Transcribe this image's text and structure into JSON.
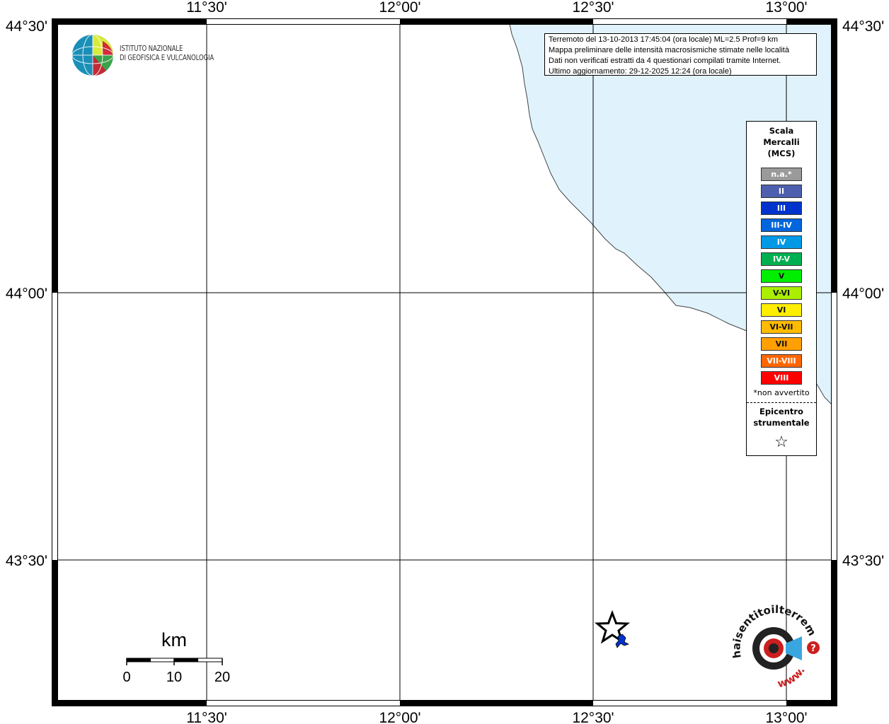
{
  "map": {
    "lon_labels": [
      "11°30'",
      "12°00'",
      "12°30'",
      "13°00'"
    ],
    "lat_labels": [
      "44°30'",
      "44°00'",
      "43°30'"
    ],
    "sea_color": "#e0f3fd",
    "frame_color": "#000000",
    "epicenter": {
      "symbol": "star-icon"
    },
    "felt_report": {
      "intensity": "III",
      "color": "#0033cc"
    }
  },
  "info": {
    "line1": "Terremoto del 13-10-2013 17:45:04 (ora locale) ML=2.5 Prof=9 km",
    "line2": "Mappa preliminare delle intensità macrosismiche stimate nelle località",
    "line3": "Dati non verificati estratti da 4 questionari compilati tramite Internet.",
    "line4": "Ultimo aggiornamento: 29-12-2025 12:24 (ora locale)"
  },
  "logo": {
    "line1": "ISTITUTO NAZIONALE",
    "line2": "DI GEOFISICA E VULCANOLOGIA"
  },
  "legend": {
    "title1": "Scala",
    "title2": "Mercalli",
    "title3": "(MCS)",
    "items": [
      {
        "label": "n.a.*",
        "color": "#9a9a9a"
      },
      {
        "label": "II",
        "color": "#4d5fae"
      },
      {
        "label": "III",
        "color": "#0033cc"
      },
      {
        "label": "III-IV",
        "color": "#0066dd"
      },
      {
        "label": "IV",
        "color": "#0099e6"
      },
      {
        "label": "IV-V",
        "color": "#00b050"
      },
      {
        "label": "V",
        "color": "#00ee00"
      },
      {
        "label": "V-VI",
        "color": "#aaee00"
      },
      {
        "label": "VI",
        "color": "#ffee00"
      },
      {
        "label": "VI-VII",
        "color": "#ffbb00"
      },
      {
        "label": "VII",
        "color": "#ffa000"
      },
      {
        "label": "VII-VIII",
        "color": "#ff6600"
      },
      {
        "label": "VIII",
        "color": "#ff0000"
      }
    ],
    "note": "*non avvertito",
    "epi1": "Epicentro",
    "epi2": "strumentale",
    "star": "☆"
  },
  "scalebar": {
    "unit": "km",
    "ticks": [
      "0",
      "10",
      "20"
    ]
  },
  "hst_logo": {
    "text_top": "haisentitoilterremoto.it",
    "text_bottom": "www.",
    "badge": "?"
  }
}
